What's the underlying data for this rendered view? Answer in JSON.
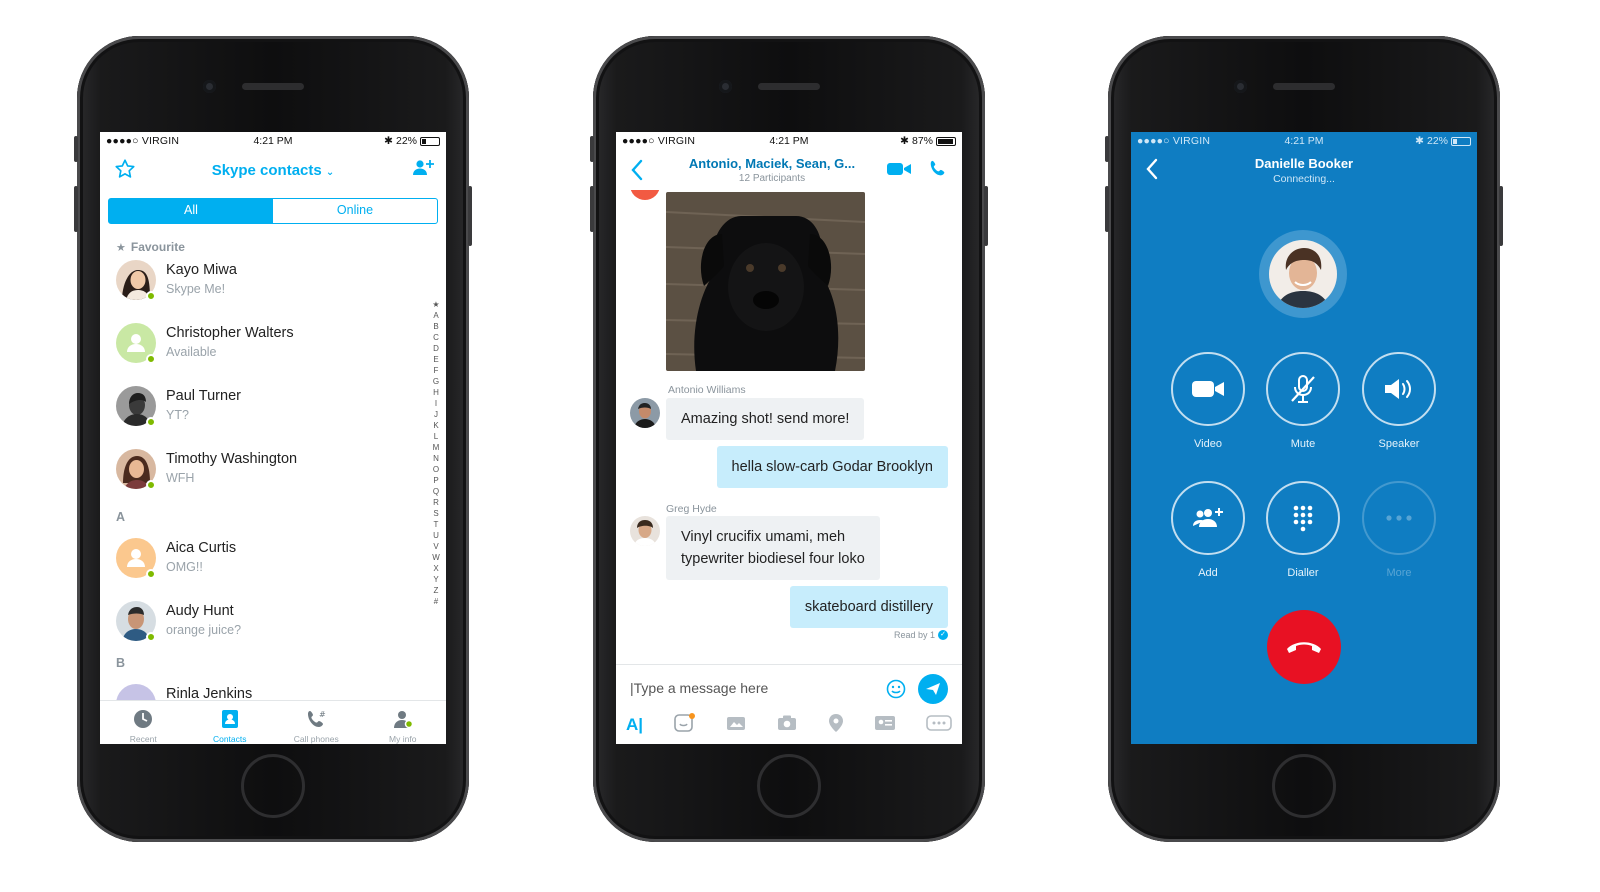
{
  "contacts_screen": {
    "status": {
      "carrier": "●●●●○ VIRGIN",
      "time": "4:21 PM",
      "battery": "22%"
    },
    "title": "Skype contacts",
    "segments": [
      "All",
      "Online"
    ],
    "favourite_label": "Favourite",
    "favourites": [
      {
        "name": "Kayo Miwa",
        "status": "Skype Me!"
      },
      {
        "name": "Christopher Walters",
        "status": "Available"
      },
      {
        "name": "Paul Turner",
        "status": "YT?"
      },
      {
        "name": "Timothy Washington",
        "status": "WFH"
      }
    ],
    "section_a": "A",
    "a_contacts": [
      {
        "name": "Aica Curtis",
        "status": "OMG!!"
      },
      {
        "name": "Audy Hunt",
        "status": "orange juice?"
      }
    ],
    "section_b": "B",
    "b_contacts": [
      {
        "name": "Rinla Jenkins"
      }
    ],
    "alpha_index": [
      "★",
      "A",
      "B",
      "C",
      "D",
      "E",
      "F",
      "G",
      "H",
      "I",
      "J",
      "K",
      "L",
      "M",
      "N",
      "O",
      "P",
      "Q",
      "R",
      "S",
      "T",
      "U",
      "V",
      "W",
      "X",
      "Y",
      "Z",
      "#"
    ],
    "tabs": [
      "Recent",
      "Contacts",
      "Call phones",
      "My info"
    ]
  },
  "chat_screen": {
    "status": {
      "carrier": "●●●●○ VIRGIN",
      "time": "4:21 PM",
      "battery": "87%"
    },
    "title": "Antonio, Maciek, Sean, G...",
    "participants": "12 Participants",
    "messages": [
      {
        "sender": "Antonio Williams",
        "text": "Amazing shot! send more!"
      },
      {
        "sender": "",
        "text": "hella slow-carb Godar Brooklyn"
      },
      {
        "sender": "Greg Hyde",
        "text_line1": "Vinyl crucifix umami, meh",
        "text_line2": "typewriter biodiesel four loko"
      },
      {
        "sender": "",
        "text": "skateboard distillery"
      }
    ],
    "read_by": "Read by 1",
    "composer_placeholder": "|Type a message here"
  },
  "call_screen": {
    "status": {
      "carrier": "●●●●○ VIRGIN",
      "time": "4:21 PM",
      "battery": "22%"
    },
    "name": "Danielle Booker",
    "state": "Connecting...",
    "buttons": [
      "Video",
      "Mute",
      "Speaker",
      "Add",
      "Dialler",
      "More"
    ]
  },
  "colors": {
    "skype_blue": "#00aff0",
    "call_blue": "#0f7dc2",
    "presence_green": "#7fba00",
    "end_call_red": "#e81123"
  }
}
